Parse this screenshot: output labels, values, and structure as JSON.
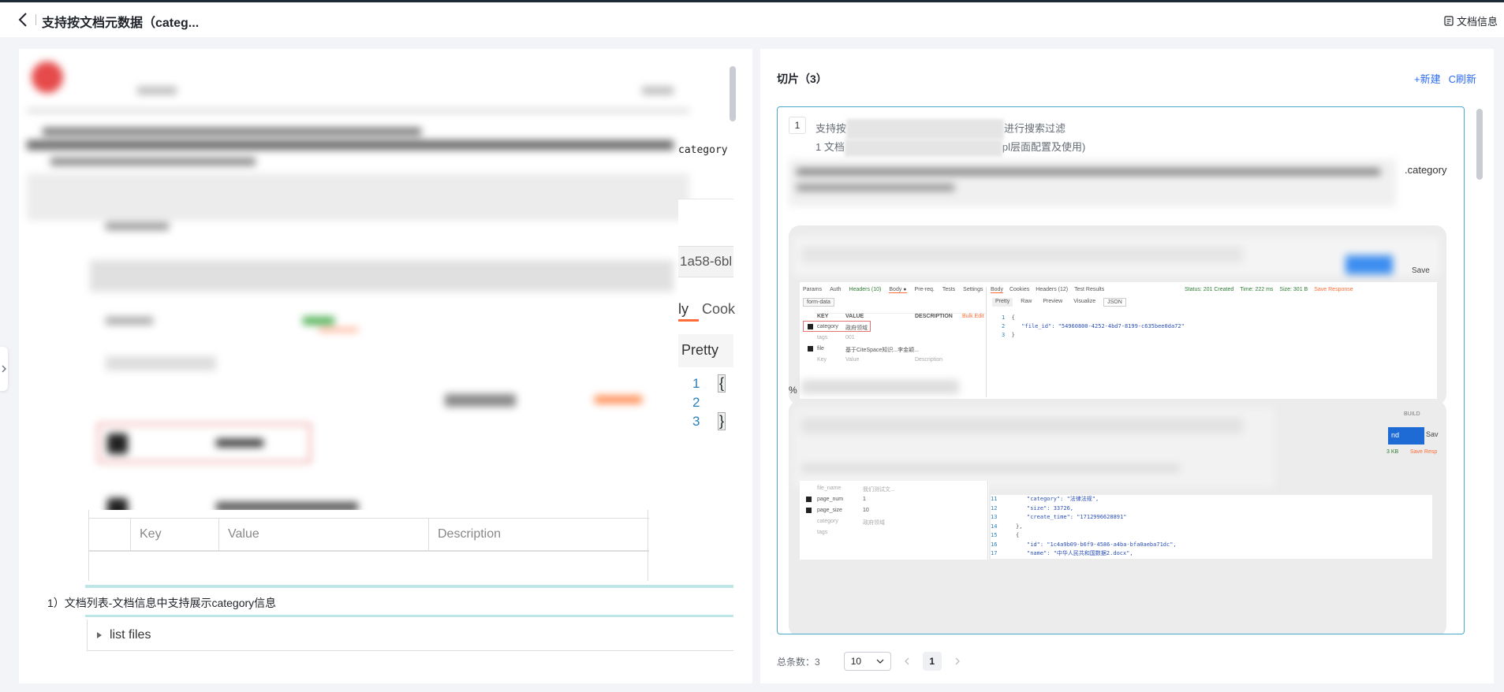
{
  "header": {
    "title": "支持按文档元数据（categ...",
    "doc_info_label": "文档信息"
  },
  "left": {
    "snippet_category": "category",
    "snippet_id": "1a58-6bl",
    "tab_body": "ly",
    "tab_cookies": "Cook",
    "pretty_label": "Pretty",
    "line_numbers": [
      "1",
      "2",
      "3"
    ],
    "brace_open": "{",
    "brace_close": "}",
    "table_headers": [
      "Key",
      "Value",
      "Description"
    ],
    "list_text": "1）文档列表-文档信息中支持展示category信息",
    "list_files_label": "list files"
  },
  "right": {
    "title": "切片（3）",
    "new_label": "+新建",
    "refresh_label": "C刷新",
    "slice": {
      "index": "1",
      "text_start": "支持按",
      "text_end": "进行搜索过滤",
      "sub_start": "1 文档",
      "sub_end": "pl层面配置及使用)",
      "side_text": ".category",
      "percent": "%"
    },
    "postman1": {
      "tabs": [
        "Params",
        "Auth",
        "Headers (10)",
        "Body ●",
        "Pre-req.",
        "Tests",
        "Settings"
      ],
      "resp_tabs": [
        "Body",
        "Cookies",
        "Headers (12)",
        "Test Results"
      ],
      "status": "Status: 201 Created",
      "time": "Time: 222 ms",
      "size": "Size: 301 B",
      "save_response": "Save Response",
      "form_data": "form-data",
      "col_key": "KEY",
      "col_value": "VALUE",
      "col_desc": "DESCRIPTION",
      "bulk_edit": "Bulk Edit",
      "rows": [
        {
          "key": "category",
          "value": "政府领域"
        },
        {
          "key": "tags",
          "value": "001"
        },
        {
          "key": "file",
          "value": "基于CiteSpace知识...李金颖..."
        },
        {
          "key": "Key",
          "value": "Value",
          "desc": "Description"
        }
      ],
      "view_tabs": [
        "Pretty",
        "Raw",
        "Preview",
        "Visualize"
      ],
      "format": "JSON",
      "code": [
        "{",
        "\"file_id\": \"54960800-4252-4bd7-8199-c635bee0da72\"",
        "}"
      ],
      "save_btn": "Save"
    },
    "postman2": {
      "rows": [
        {
          "key": "file_name",
          "value": "我们测试文..."
        },
        {
          "key": "page_num",
          "value": "1"
        },
        {
          "key": "page_size",
          "value": "10"
        },
        {
          "key": "category",
          "value": "政府领域"
        },
        {
          "key": "tags",
          "value": ""
        }
      ],
      "line_nums": [
        "11",
        "12",
        "13",
        "14",
        "15",
        "16",
        "17"
      ],
      "code": [
        "\"category\": \"法律法规\",",
        "\"size\": 33726,",
        "\"create_time\": \"1712996628891\"",
        "},",
        "{",
        "\"id\": \"1c4a9b09-b6f9-4586-a4ba-bfa0aeba71dc\",",
        "\"name\": \"中华人民共和国数据2.docx\","
      ],
      "send_btn": "nd",
      "save_btn": "Sav",
      "build_label": "BUILD",
      "size_label": "3 KB",
      "save_resp": "Save Resp"
    },
    "pager": {
      "total_label": "总条数：3",
      "page_size": "10",
      "current_page": "1"
    }
  }
}
